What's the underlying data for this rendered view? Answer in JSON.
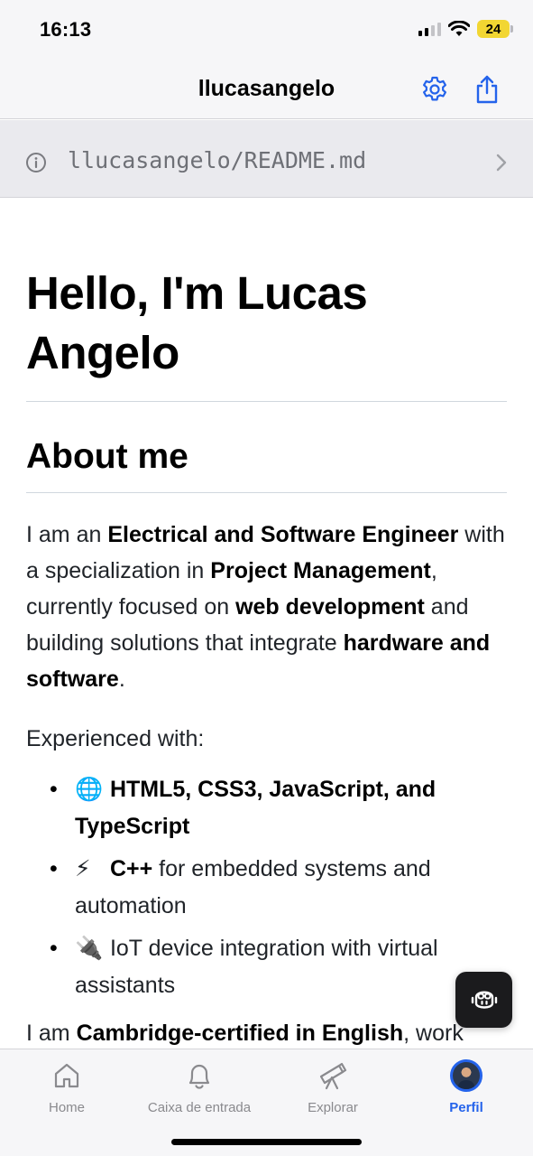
{
  "status_bar": {
    "time": "16:13",
    "battery_level": "24",
    "battery_color": "#f2d632"
  },
  "nav": {
    "title": "llucasangelo",
    "icons": [
      "gear-icon",
      "share-icon"
    ],
    "accent_color": "#2463eb"
  },
  "path_row": {
    "path": "llucasangelo/README.md"
  },
  "readme": {
    "heading": "Hello, I'm Lucas Angelo",
    "about_heading": "About me",
    "about_paragraph": [
      {
        "text": "I am an ",
        "bold": false
      },
      {
        "text": "Electrical and Software Engineer",
        "bold": true
      },
      {
        "text": " with a specialization in ",
        "bold": false
      },
      {
        "text": "Project Management",
        "bold": true
      },
      {
        "text": ", currently focused on ",
        "bold": false
      },
      {
        "text": "web development",
        "bold": true
      },
      {
        "text": " and building solutions that integrate ",
        "bold": false
      },
      {
        "text": "hardware and software",
        "bold": true
      },
      {
        "text": ".",
        "bold": false
      }
    ],
    "experienced_label": "Experienced with:",
    "experience_items": [
      {
        "emoji": "🌐",
        "bold": "HTML5, CSS3, JavaScript, and TypeScript",
        "rest": ""
      },
      {
        "emoji": "⚡",
        "bold": "C++",
        "rest": " for embedded systems and automation"
      },
      {
        "emoji": "🔌",
        "bold": "",
        "rest": "IoT device integration with virtual assistants"
      }
    ],
    "certified_paragraph": [
      {
        "text": "I am ",
        "bold": false
      },
      {
        "text": "Cambridge-certified in English",
        "bold": true
      },
      {
        "text": ", work",
        "bold": false
      }
    ]
  },
  "tab_bar": {
    "tabs": [
      {
        "label": "Home",
        "icon": "home-icon",
        "active": false
      },
      {
        "label": "Caixa de entrada",
        "icon": "bell-icon",
        "active": false
      },
      {
        "label": "Explorar",
        "icon": "telescope-icon",
        "active": false
      },
      {
        "label": "Perfil",
        "icon": "avatar",
        "active": true
      }
    ]
  }
}
